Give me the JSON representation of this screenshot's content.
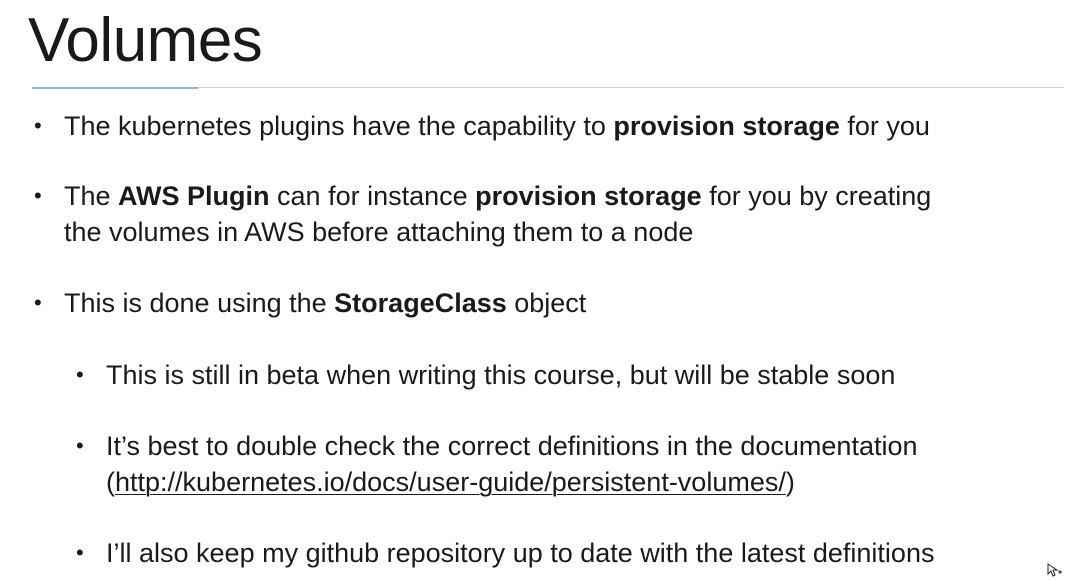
{
  "slide": {
    "title": "Volumes",
    "accent_color": "#8fb3d9",
    "bullets": [
      {
        "level": 1,
        "parts": [
          "The kubernetes plugins have the capability to ",
          "provision storage",
          " for you"
        ]
      },
      {
        "level": 1,
        "line1": [
          "The ",
          "AWS Plugin",
          " can for instance ",
          "provision storage",
          " for you by creating"
        ],
        "line2": "the volumes in AWS before attaching them to a node"
      },
      {
        "level": 1,
        "parts": [
          "This is done using the ",
          "StorageClass",
          " object"
        ]
      },
      {
        "level": 2,
        "text": "This is still in beta when writing this course, but will be stable soon"
      },
      {
        "level": 2,
        "line1": "It’s best to double check the correct definitions in the documentation",
        "line2_open": "(",
        "link": "http://kubernetes.io/docs/user-guide/persistent-volumes/",
        "line2_close": ")"
      },
      {
        "level": 2,
        "text": "I’ll also keep my github repository up to date with the latest definitions"
      }
    ],
    "bullet_glyph": "•",
    "cursor_icon": "move-cursor-icon"
  }
}
